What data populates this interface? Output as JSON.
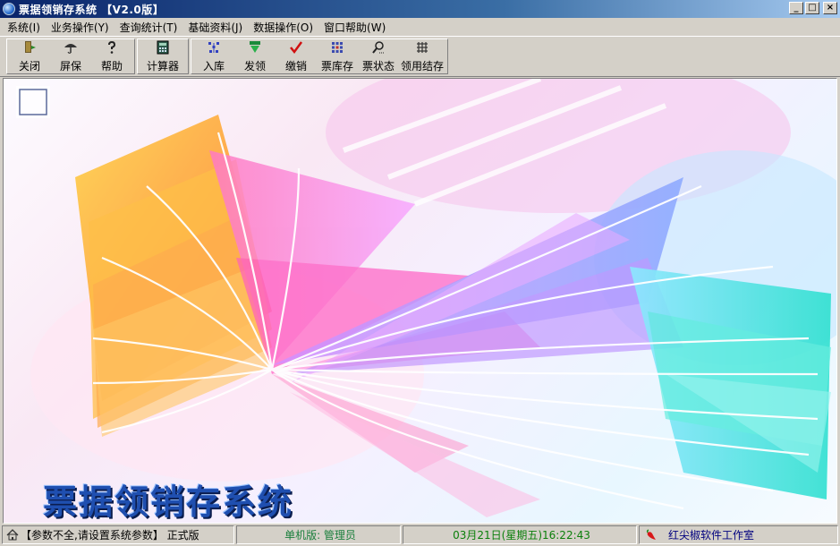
{
  "window": {
    "title": "票据领销存系统 【V2.0版】",
    "buttons": [
      "_",
      "□",
      "×"
    ]
  },
  "menu": [
    {
      "label": "系统(I)"
    },
    {
      "label": "业务操作(Y)"
    },
    {
      "label": "查询统计(T)"
    },
    {
      "label": "基础资料(J)"
    },
    {
      "label": "数据操作(O)"
    },
    {
      "label": "窗口帮助(W)"
    }
  ],
  "toolbar": {
    "close": "关闭",
    "screensaver": "屏保",
    "help": "帮助",
    "calculator": "计算器",
    "stock_in": "入库",
    "issue": "发领",
    "cancel": "缴销",
    "ticket_stock": "票库存",
    "ticket_status": "票状态",
    "use_settle": "领用结存"
  },
  "splash": {
    "title": "票据领销存系统"
  },
  "status": {
    "message": "【参数不全,请设置系统参数】 正式版",
    "edition": "单机版: 管理员",
    "datetime": "03月21日(星期五)16:22:43",
    "vendor": "红尖椒软件工作室"
  },
  "colors": {
    "title_bar_start": "#0a246a",
    "title_bar_end": "#a6caf0",
    "chrome": "#d4d0c8",
    "splash_text": "#1f4fb0"
  }
}
